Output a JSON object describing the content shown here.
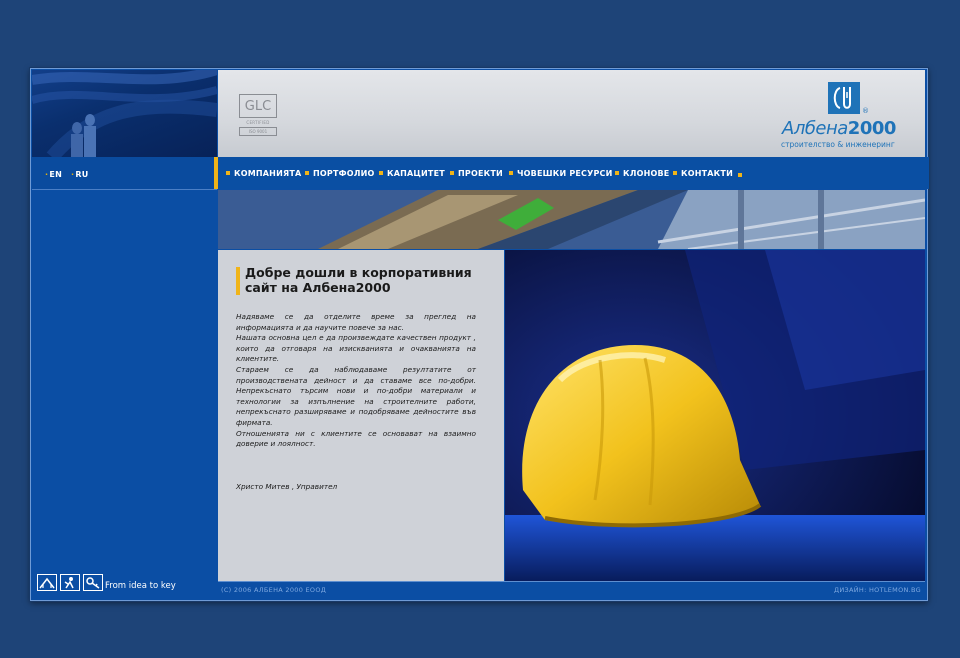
{
  "languages": [
    {
      "code": "EN"
    },
    {
      "code": "RU"
    }
  ],
  "header": {
    "glc": {
      "main": "GLC",
      "certified": "CERTIFIED",
      "iso": "ISO 9001"
    },
    "logo": {
      "name_left": "Албена",
      "name_right": "2000",
      "registered": "®",
      "subtitle": "строителство & инженеринг"
    }
  },
  "nav": {
    "items": [
      {
        "label": "КОМПАНИЯТА"
      },
      {
        "label": "ПОРТФОЛИО"
      },
      {
        "label": "КАПАЦИТЕТ"
      },
      {
        "label": "ПРОЕКТИ"
      },
      {
        "label": "ЧОВЕШКИ РЕСУРСИ"
      },
      {
        "label": "КЛОНОВЕ"
      },
      {
        "label": "КОНТАКТИ"
      }
    ]
  },
  "main": {
    "title": "Добре дошли в корпоративния сайт на Албена2000",
    "paragraphs": [
      "Надяваме се да отделите време за преглед на информацията и да научите повече за нас.",
      "Нашата основна цел е да произвеждате качествен продукт , които да отговаря на изискванията и очакванията на клиентите.",
      "Стараем се да наблюдаваме резултатите от производствената дейност и да ставаме все по-добри. Непрекъснато търсим нови и по-добри материали и технологии за изпълнение на строителните работи, непрекъснато разширяваме и подобряваме дейностите във фирмата.",
      "Отношенията ни с клиентите се основават на взаимно доверие и лоялност."
    ],
    "signature": "Христо Митев , Управител"
  },
  "left_bottom": {
    "icons": [
      "home-icon",
      "worker-icon",
      "key-icon"
    ],
    "slogan": "From idea to key"
  },
  "footer": {
    "copyright": "(C) 2006 АЛБЕНА 2000 ЕООД",
    "design": "ДИЗАЙН: HOTLEMON.BG"
  },
  "colors": {
    "page_bg": "#1e4478",
    "panel_blue": "#0b4ea4",
    "accent_yellow": "#f0b419",
    "content_gray": "#cfd2d8",
    "logo_blue": "#1f73b8"
  }
}
